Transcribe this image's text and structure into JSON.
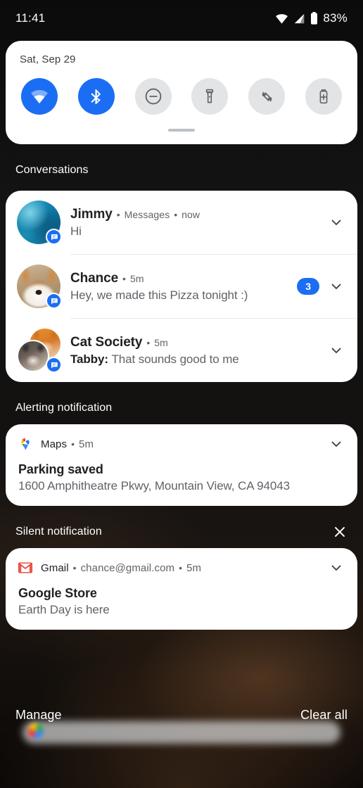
{
  "status_bar": {
    "clock": "11:41",
    "battery_percent": "83%",
    "icons": [
      "wifi-icon",
      "cellular-signal-icon",
      "battery-icon"
    ]
  },
  "quick_settings": {
    "date": "Sat, Sep 29",
    "tiles": [
      {
        "name": "wifi",
        "label": "Wi-Fi",
        "icon": "wifi-icon",
        "active": true
      },
      {
        "name": "bluetooth",
        "label": "Bluetooth",
        "icon": "bluetooth-icon",
        "active": true
      },
      {
        "name": "dnd",
        "label": "Do Not Disturb",
        "icon": "do-not-disturb-icon",
        "active": false
      },
      {
        "name": "flashlight",
        "label": "Flashlight",
        "icon": "flashlight-icon",
        "active": false
      },
      {
        "name": "auto-rotate",
        "label": "Auto-rotate",
        "icon": "auto-rotate-icon",
        "active": false
      },
      {
        "name": "battery-saver",
        "label": "Battery Saver",
        "icon": "battery-saver-icon",
        "active": false
      }
    ],
    "active_color": "#1b6ef3",
    "inactive_color": "#e2e4e6"
  },
  "sections": {
    "conversations": {
      "title": "Conversations"
    },
    "alerting": {
      "title": "Alerting notification"
    },
    "silent": {
      "title": "Silent notification",
      "close_icon": "close-icon"
    }
  },
  "conversations": [
    {
      "sender": "Jimmy",
      "app": "Messages",
      "time": "now",
      "message": "Hi",
      "message_prefix": "",
      "badge_count": "",
      "avatar": "jimmy-avatar",
      "app_badge": "messages-badge-icon"
    },
    {
      "sender": "Chance",
      "app": "",
      "time": "5m",
      "message": "Hey, we made this Pizza tonight :)",
      "message_prefix": "",
      "badge_count": "3",
      "avatar": "chance-dog-avatar",
      "app_badge": "messages-badge-icon"
    },
    {
      "sender": "Cat Society",
      "app": "",
      "time": "5m",
      "message": "That sounds good to me",
      "message_prefix": "Tabby",
      "badge_count": "",
      "avatar": "cat-society-group-avatar",
      "app_badge": "messages-badge-icon"
    }
  ],
  "alerting_notification": {
    "app_name": "Maps",
    "app_icon": "google-maps-pin-icon",
    "time": "5m",
    "title": "Parking saved",
    "body": "1600 Amphitheatre Pkwy, Mountain View, CA 94043"
  },
  "silent_notification": {
    "app_name": "Gmail",
    "app_icon": "gmail-icon",
    "account": "chance@gmail.com",
    "time": "5m",
    "title": "Google Store",
    "body": "Earth Day is here"
  },
  "footer": {
    "manage_label": "Manage",
    "clear_all_label": "Clear all"
  },
  "separators": {
    "dot": "•"
  }
}
